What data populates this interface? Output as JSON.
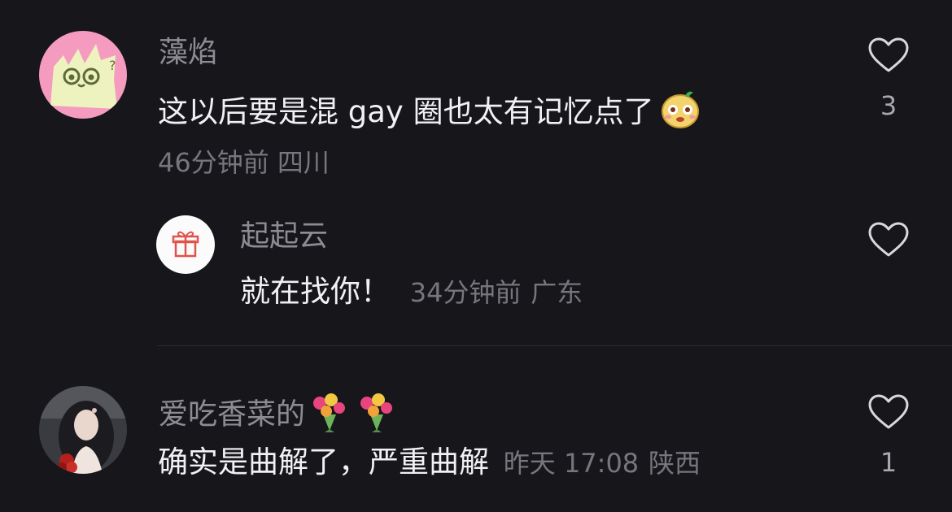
{
  "comments": [
    {
      "author": "藻焰",
      "text": "这以后要是混 gay 圈也太有记忆点了",
      "emoji": "smiling-face-sticker",
      "time": "46分钟前",
      "location": "四川",
      "likes": "3"
    },
    {
      "author": "起起云",
      "text": "就在找你！",
      "time": "34分钟前",
      "location": "广东",
      "avatar_icon": "gift-icon"
    },
    {
      "author": "爱吃香菜的",
      "author_emoji": "bouquet-icon",
      "text": "确实是曲解了，严重曲解",
      "time": "昨天 17:08",
      "location": "陕西",
      "likes": "1"
    }
  ],
  "colors": {
    "background": "#17161b",
    "text_primary": "#f1f1f3",
    "text_secondary": "#8d8c93",
    "meta": "#77767d"
  }
}
